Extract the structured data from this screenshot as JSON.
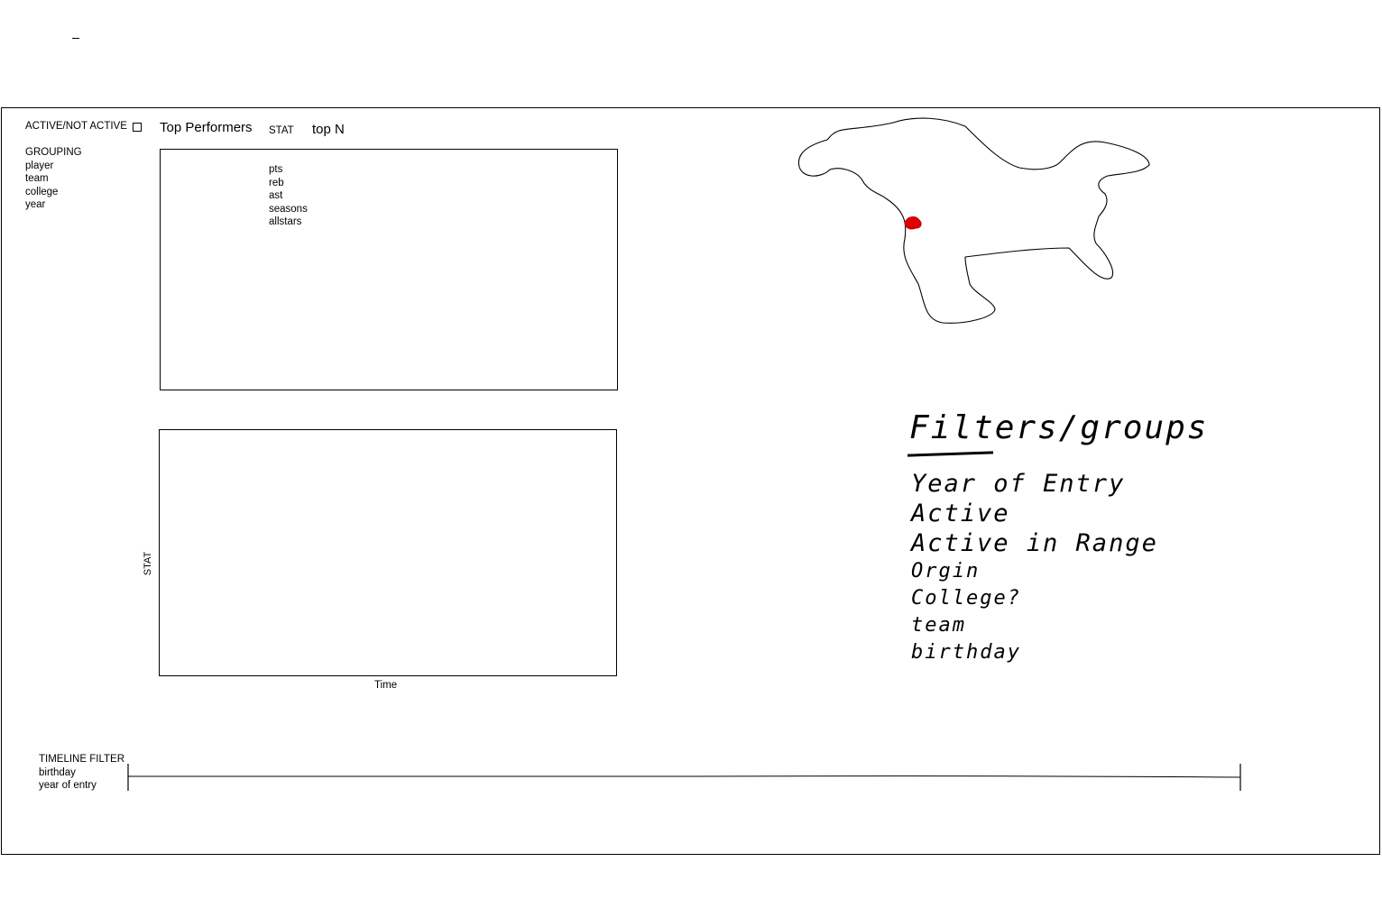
{
  "controls": {
    "active_toggle_label": "ACTIVE/NOT ACTIVE"
  },
  "grouping": {
    "heading": "GROUPING",
    "options": [
      "player",
      "team",
      "college",
      "year"
    ]
  },
  "top_performers": {
    "title": "Top Performers",
    "stat_label": "STAT",
    "top_n_label": "top N",
    "stat_options": [
      "pts",
      "reb",
      "ast",
      "seasons",
      "allstars"
    ]
  },
  "time_chart": {
    "y_label": "STAT",
    "x_label": "Time"
  },
  "timeline": {
    "heading": "TIMELINE FILTER",
    "options": [
      "birthday",
      "year of entry"
    ]
  },
  "map": {
    "outline_color": "#000000",
    "marker_color": "#e00000"
  },
  "notes": {
    "title": "Filters/groups",
    "items": [
      "Year of Entry",
      "Active",
      "Active in Range",
      "Orgin",
      "College?",
      "team",
      "birthday"
    ]
  }
}
